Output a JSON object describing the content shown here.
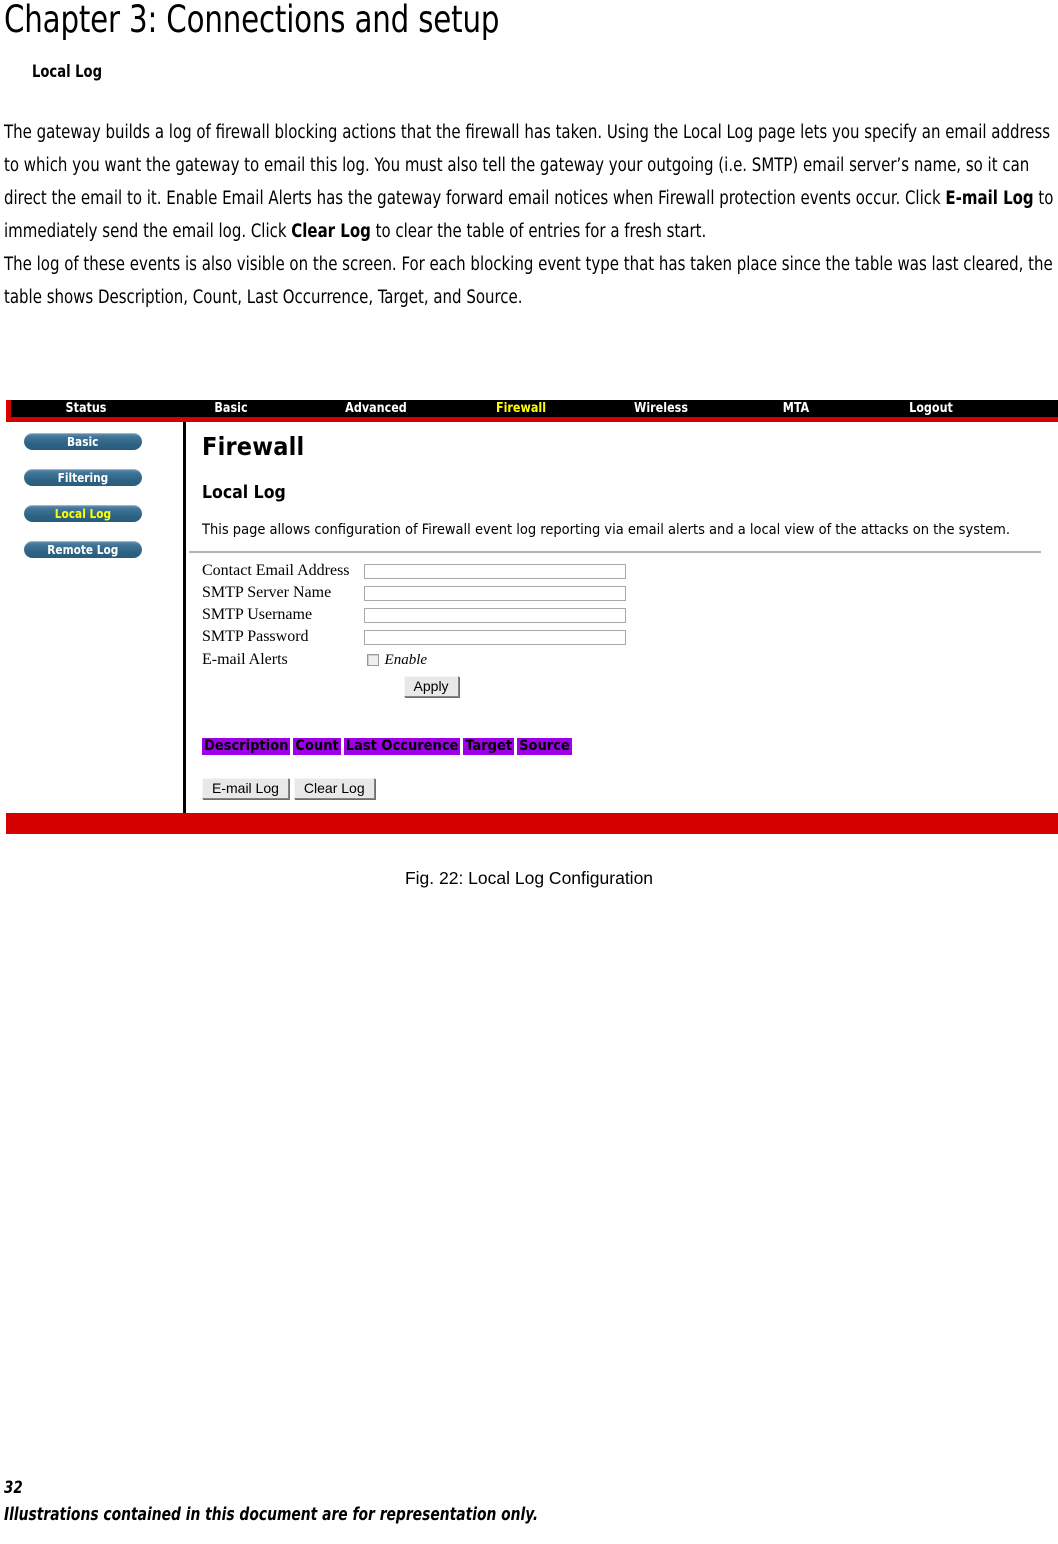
{
  "document": {
    "chapter_title": "Chapter 3: Connections and setup",
    "section_title": "Local Log",
    "paragraphs": [
      "The gateway builds a log of firewall blocking actions that the firewall has taken. Using the Local Log page lets you specify an email address to which you want the gateway to email this log. You must also tell the gateway your outgoing (i.e. SMTP) email server’s name, so it can direct the email to it. Enable Email Alerts has the gateway forward email notices when Firewall protection events occur. Click ",
      " to immediately send the email log. Click ",
      " to clear the table of entries for a fresh start."
    ],
    "bold_1": "E-mail Log",
    "bold_2": "Clear Log",
    "paragraph_2": "The log of these events is also visible on the screen. For each blocking event type that has taken place since the table was last cleared, the table shows Description, Count, Last Occurrence, Target, and Source.",
    "figure_caption": "Fig. 22: Local Log Configuration",
    "page_number": "32",
    "footer_note": "Illustrations contained in this document are for representation only."
  },
  "screenshot": {
    "topnav": {
      "active": "Firewall",
      "items": [
        {
          "label": "Status"
        },
        {
          "label": "Basic"
        },
        {
          "label": "Advanced"
        },
        {
          "label": "Firewall"
        },
        {
          "label": "Wireless"
        },
        {
          "label": "MTA"
        },
        {
          "label": "Logout"
        }
      ],
      "bar_color": "#000000",
      "accent_color": "#d50000",
      "active_color": "#ffff00"
    },
    "sidebar": {
      "active": "Local Log",
      "items": [
        {
          "label": "Basic"
        },
        {
          "label": "Filtering"
        },
        {
          "label": "Local Log"
        },
        {
          "label": "Remote Log"
        }
      ],
      "button_color": "#2f6485",
      "active_text_color": "#ffff00"
    },
    "content": {
      "heading": "Firewall",
      "subheading": "Local Log",
      "description": "This page allows configuration of Firewall event log reporting via email alerts and a local view of the attacks on the system.",
      "fields": [
        {
          "label": "Contact Email Address",
          "value": "",
          "placeholder": ""
        },
        {
          "label": "SMTP Server Name",
          "value": "",
          "placeholder": ""
        },
        {
          "label": "SMTP Username",
          "value": "",
          "placeholder": ""
        },
        {
          "label": "SMTP Password",
          "value": "",
          "placeholder": ""
        }
      ],
      "email_alerts": {
        "label": "E-mail Alerts",
        "checkbox_label": "Enable",
        "checked": false
      },
      "apply_button": "Apply",
      "log_table": {
        "header_color": "#9d00e8",
        "columns": [
          "Description",
          "Count",
          "Last Occurence",
          "Target",
          "Source"
        ],
        "rows": []
      },
      "email_log_button": "E-mail Log",
      "clear_log_button": "Clear Log"
    },
    "footer_bar_color": "#d50000"
  }
}
